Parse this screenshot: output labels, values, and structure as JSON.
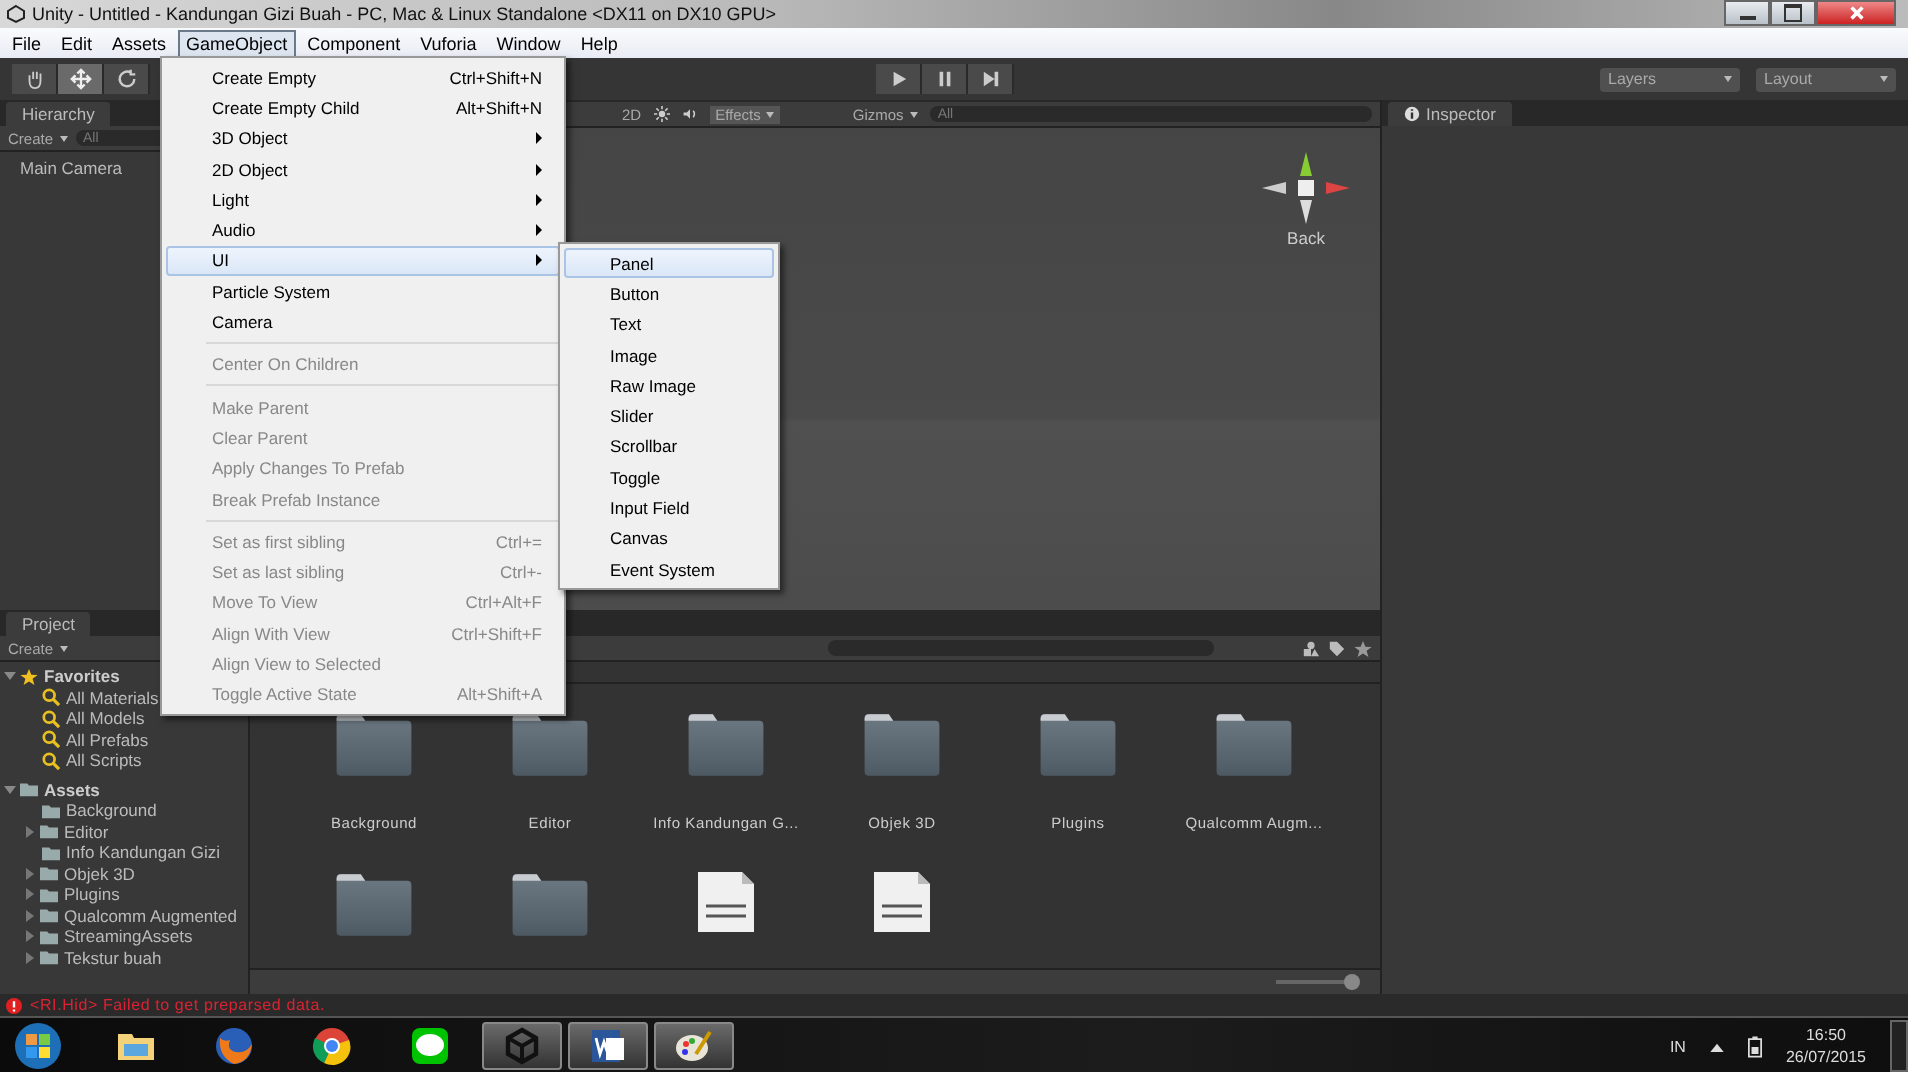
{
  "window": {
    "title": "Unity - Untitled - Kandungan Gizi Buah - PC, Mac & Linux Standalone <DX11 on DX10 GPU>"
  },
  "menu_bar": [
    {
      "label": "File",
      "selected": false
    },
    {
      "label": "Edit",
      "selected": false
    },
    {
      "label": "Assets",
      "selected": false
    },
    {
      "label": "GameObject",
      "selected": true
    },
    {
      "label": "Component",
      "selected": false
    },
    {
      "label": "Vuforia",
      "selected": false
    },
    {
      "label": "Window",
      "selected": false
    },
    {
      "label": "Help",
      "selected": false
    }
  ],
  "toolbar": {
    "tools": [
      {
        "kind": "hand",
        "selected": false
      },
      {
        "kind": "move",
        "selected": true
      },
      {
        "kind": "rotate",
        "selected": false
      }
    ],
    "layers": "Layers",
    "layout": "Layout"
  },
  "hierarchy": {
    "tab": "Hierarchy",
    "create": "Create",
    "search_placeholder": "All",
    "items": [
      "Main Camera"
    ]
  },
  "scene": {
    "mode": "2D",
    "effects": "Effects",
    "gizmos": "Gizmos",
    "search_placeholder": "All",
    "gizmo_label": "Back"
  },
  "inspector": {
    "tab": "Inspector"
  },
  "project": {
    "tab": "Project",
    "create": "Create",
    "tree": [
      {
        "label": "Favorites",
        "kind": "favorites",
        "expandable": true,
        "children": [
          {
            "label": "All Materials",
            "kind": "search",
            "expandable": false
          },
          {
            "label": "All Models",
            "kind": "search",
            "expandable": false
          },
          {
            "label": "All Prefabs",
            "kind": "search",
            "expandable": false
          },
          {
            "label": "All Scripts",
            "kind": "search",
            "expandable": false
          }
        ]
      },
      {
        "label": "Assets",
        "kind": "folder",
        "expandable": true,
        "children": [
          {
            "label": "Background",
            "kind": "folder",
            "expandable": false
          },
          {
            "label": "Editor",
            "kind": "folder",
            "expandable": true
          },
          {
            "label": "Info Kandungan Gizi",
            "kind": "folder",
            "expandable": false
          },
          {
            "label": "Objek 3D",
            "kind": "folder",
            "expandable": true
          },
          {
            "label": "Plugins",
            "kind": "folder",
            "expandable": true
          },
          {
            "label": "Qualcomm Augmented",
            "kind": "folder",
            "expandable": true
          },
          {
            "label": "StreamingAssets",
            "kind": "folder",
            "expandable": true
          },
          {
            "label": "Tekstur buah",
            "kind": "folder",
            "expandable": true
          }
        ]
      }
    ],
    "grid": [
      {
        "kind": "folder",
        "label": "Background"
      },
      {
        "kind": "folder",
        "label": "Editor"
      },
      {
        "kind": "folder",
        "label": "Info Kandungan G..."
      },
      {
        "kind": "folder",
        "label": "Objek 3D"
      },
      {
        "kind": "folder",
        "label": "Plugins"
      },
      {
        "kind": "folder",
        "label": "Qualcomm Augm..."
      },
      {
        "kind": "folder"
      },
      {
        "kind": "folder"
      },
      {
        "kind": "document"
      },
      {
        "kind": "document"
      }
    ],
    "zoom_slider": {
      "level": 0.95
    }
  },
  "gameobject_menu": [
    {
      "kind": "item",
      "label": "Create Empty",
      "shortcut": "Ctrl+Shift+N",
      "submenu": false,
      "disabled": false,
      "selected": false
    },
    {
      "kind": "item",
      "label": "Create Empty Child",
      "shortcut": "Alt+Shift+N",
      "submenu": false,
      "disabled": false,
      "selected": false
    },
    {
      "kind": "item",
      "label": "3D Object",
      "submenu": true,
      "disabled": false,
      "selected": false
    },
    {
      "kind": "item",
      "label": "2D Object",
      "submenu": true,
      "disabled": false,
      "selected": false
    },
    {
      "kind": "item",
      "label": "Light",
      "submenu": true,
      "disabled": false,
      "selected": false
    },
    {
      "kind": "item",
      "label": "Audio",
      "submenu": true,
      "disabled": false,
      "selected": false
    },
    {
      "kind": "item",
      "label": "UI",
      "submenu": true,
      "disabled": false,
      "selected": true
    },
    {
      "kind": "item",
      "label": "Particle System",
      "submenu": false,
      "disabled": false,
      "selected": false
    },
    {
      "kind": "item",
      "label": "Camera",
      "submenu": false,
      "disabled": false,
      "selected": false
    },
    {
      "kind": "separator"
    },
    {
      "kind": "item",
      "label": "Center On Children",
      "submenu": false,
      "disabled": true,
      "selected": false
    },
    {
      "kind": "separator"
    },
    {
      "kind": "item",
      "label": "Make Parent",
      "submenu": false,
      "disabled": true,
      "selected": false
    },
    {
      "kind": "item",
      "label": "Clear Parent",
      "submenu": false,
      "disabled": true,
      "selected": false
    },
    {
      "kind": "item",
      "label": "Apply Changes To Prefab",
      "submenu": false,
      "disabled": true,
      "selected": false
    },
    {
      "kind": "item",
      "label": "Break Prefab Instance",
      "submenu": false,
      "disabled": true,
      "selected": false
    },
    {
      "kind": "separator"
    },
    {
      "kind": "item",
      "label": "Set as first sibling",
      "shortcut": "Ctrl+=",
      "submenu": false,
      "disabled": true,
      "selected": false
    },
    {
      "kind": "item",
      "label": "Set as last sibling",
      "shortcut": "Ctrl+-",
      "submenu": false,
      "disabled": true,
      "selected": false
    },
    {
      "kind": "item",
      "label": "Move To View",
      "shortcut": "Ctrl+Alt+F",
      "submenu": false,
      "disabled": true,
      "selected": false
    },
    {
      "kind": "item",
      "label": "Align With View",
      "shortcut": "Ctrl+Shift+F",
      "submenu": false,
      "disabled": true,
      "selected": false
    },
    {
      "kind": "item",
      "label": "Align View to Selected",
      "submenu": false,
      "disabled": true,
      "selected": false
    },
    {
      "kind": "item",
      "label": "Toggle Active State",
      "shortcut": "Alt+Shift+A",
      "submenu": false,
      "disabled": true,
      "selected": false
    }
  ],
  "ui_submenu": [
    {
      "label": "Panel",
      "selected": true
    },
    {
      "label": "Button",
      "selected": false
    },
    {
      "label": "Text",
      "selected": false
    },
    {
      "label": "Image",
      "selected": false
    },
    {
      "label": "Raw Image",
      "selected": false
    },
    {
      "label": "Slider",
      "selected": false
    },
    {
      "label": "Scrollbar",
      "selected": false
    },
    {
      "label": "Toggle",
      "selected": false
    },
    {
      "label": "Input Field",
      "selected": false
    },
    {
      "label": "Canvas",
      "selected": false
    },
    {
      "label": "Event System",
      "selected": false
    }
  ],
  "status_bar": {
    "message": "<RI.Hid> Failed to get preparsed data."
  },
  "taskbar": {
    "apps": [
      {
        "kind": "explorer",
        "selected": false
      },
      {
        "kind": "firefox",
        "selected": false
      },
      {
        "kind": "chrome",
        "selected": false
      },
      {
        "kind": "chat",
        "selected": false
      },
      {
        "kind": "unity",
        "selected": true
      },
      {
        "kind": "word",
        "selected": true
      },
      {
        "kind": "paint",
        "selected": true
      }
    ],
    "language": "IN",
    "time": "16:50",
    "date": "26/07/2015"
  }
}
